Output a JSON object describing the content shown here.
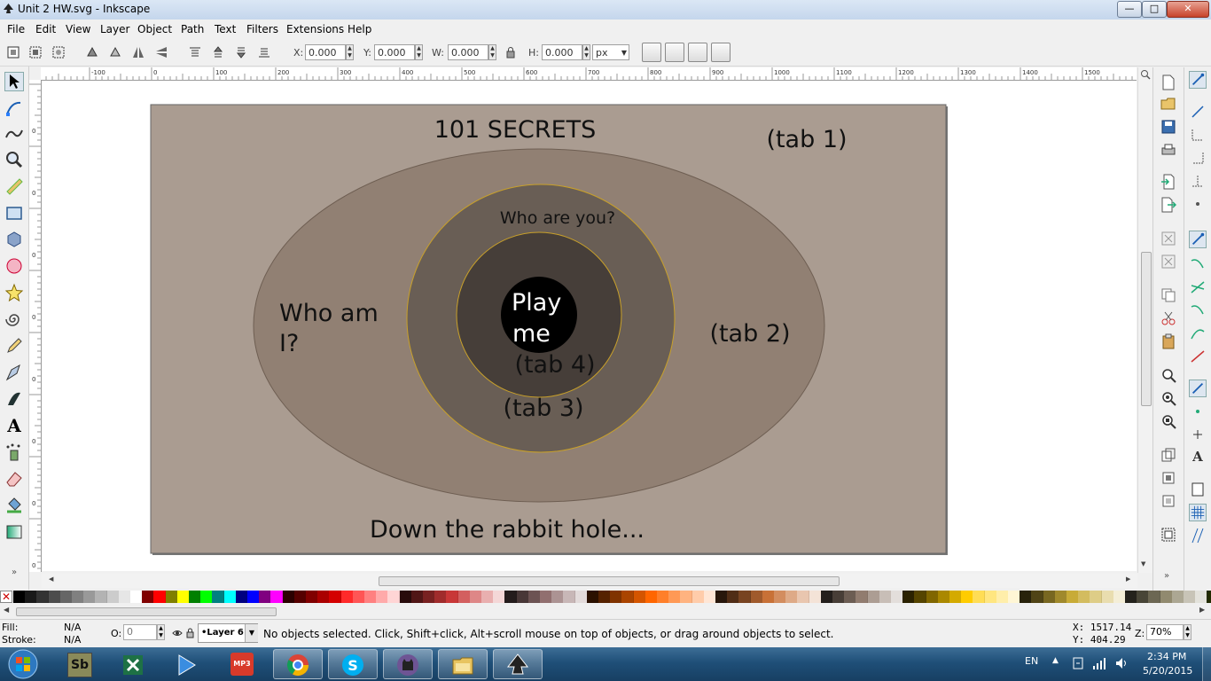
{
  "window": {
    "title": "Unit 2 HW.svg - Inkscape",
    "minimize": "—",
    "maximize": "□",
    "close": "✕"
  },
  "menu": [
    "File",
    "Edit",
    "View",
    "Layer",
    "Object",
    "Path",
    "Text",
    "Filters",
    "Extensions",
    "Help"
  ],
  "toolbar": {
    "x_label": "X:",
    "x_value": "0.000",
    "y_label": "Y:",
    "y_value": "0.000",
    "w_label": "W:",
    "w_value": "0.000",
    "h_label": "H:",
    "h_value": "0.000",
    "unit": "px"
  },
  "ruler": {
    "h_ticks": [
      "-100",
      "0",
      "100",
      "200",
      "300",
      "400",
      "500",
      "600",
      "700",
      "800",
      "900",
      "1000",
      "1100",
      "1200",
      "1300",
      "1400",
      "1500"
    ],
    "v_ticks": [
      "0",
      "0",
      "0",
      "0",
      "0",
      "0",
      "0",
      "0",
      "0",
      "0"
    ]
  },
  "drawing": {
    "title": "101 SECRETS",
    "tab1": "(tab 1)",
    "tab2": "(tab 2)",
    "tab3": "(tab 3)",
    "tab4": "(tab 4)",
    "who_are_you": "Who are you?",
    "who_am_i_line1": "Who am",
    "who_am_i_line2": "I?",
    "play_line1": "Play",
    "play_line2": "me",
    "footer": "Down the rabbit hole...",
    "colors": {
      "page": "#aa9c91",
      "outer_ellipse": "#918073",
      "middle_circle": "#695e55",
      "inner_circle": "#463e39",
      "center": "#000000",
      "stroke_gold": "#c8a02a"
    }
  },
  "palette": {
    "colors": [
      "#000000",
      "#1a1a1a",
      "#333333",
      "#4d4d4d",
      "#666666",
      "#808080",
      "#999999",
      "#b3b3b3",
      "#cccccc",
      "#e6e6e6",
      "#ffffff",
      "#800000",
      "#ff0000",
      "#808000",
      "#ffff00",
      "#008000",
      "#00ff00",
      "#008080",
      "#00ffff",
      "#000080",
      "#0000ff",
      "#800080",
      "#ff00ff",
      "#2b0000",
      "#550000",
      "#800000",
      "#aa0000",
      "#d40000",
      "#ff2a2a",
      "#ff5555",
      "#ff8080",
      "#ffaaaa",
      "#ffd5d5",
      "#280b0b",
      "#501616",
      "#782121",
      "#a02c2c",
      "#c83737",
      "#d35f5f",
      "#de8787",
      "#e9afaf",
      "#f4d7d7",
      "#241c1c",
      "#483737",
      "#6c5353",
      "#916f6f",
      "#ac9393",
      "#c8b7b7",
      "#e3dbdb",
      "#2b1100",
      "#552200",
      "#803300",
      "#aa4400",
      "#d45500",
      "#ff6600",
      "#ff7f2a",
      "#ff9955",
      "#ffb380",
      "#ffccaa",
      "#ffe6d5",
      "#28170b",
      "#502d16",
      "#784421",
      "#a05a2c",
      "#c87137",
      "#d38d5f",
      "#deaa87",
      "#e9c6af",
      "#f4e3d7",
      "#241f1c",
      "#483e37",
      "#6c5d53",
      "#917c6f",
      "#ac9d93",
      "#c8beb7",
      "#e3dedb",
      "#2b2200",
      "#554400",
      "#806600",
      "#aa8800",
      "#d4aa00",
      "#ffcc00",
      "#ffdd55",
      "#ffe680",
      "#ffeeaa",
      "#fff6d5",
      "#28220b",
      "#504416",
      "#786721",
      "#a0892c",
      "#c8ab37",
      "#d3bc5f",
      "#decd87",
      "#e9ddaf",
      "#f4eed7",
      "#24221c",
      "#484537",
      "#6c6753",
      "#918a6f",
      "#aca793",
      "#c8c4b7",
      "#e3e2db",
      "#222b00",
      "#445500",
      "#668000"
    ]
  },
  "status": {
    "fill_label": "Fill:",
    "fill_value": "N/A",
    "stroke_label": "Stroke:",
    "stroke_value": "N/A",
    "opacity_label": "O:",
    "opacity_value": "0",
    "layer": "•Layer 6",
    "message": "No objects selected. Click, Shift+click, Alt+scroll mouse on top of objects, or drag around objects to select.",
    "x_coord": "X: 1517.14",
    "y_coord": "Y:  404.29",
    "zoom_label": "Z:",
    "zoom_value": "70%"
  },
  "taskbar": {
    "lang": "EN",
    "time": "2:34 PM",
    "date": "5/20/2015",
    "apps": [
      "start-orb",
      "snagit",
      "excel",
      "media-player",
      "mp3-tool",
      "chrome",
      "skype",
      "github",
      "explorer",
      "inkscape"
    ]
  }
}
